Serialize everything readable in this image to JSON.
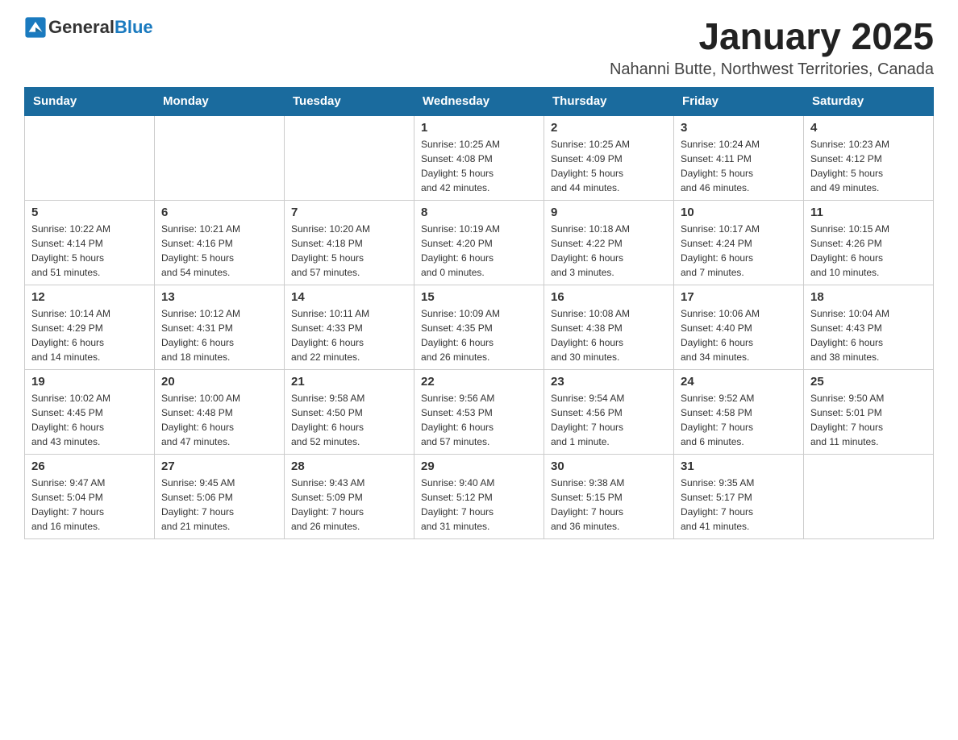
{
  "logo": {
    "general": "General",
    "blue": "Blue"
  },
  "title": "January 2025",
  "subtitle": "Nahanni Butte, Northwest Territories, Canada",
  "days_header": [
    "Sunday",
    "Monday",
    "Tuesday",
    "Wednesday",
    "Thursday",
    "Friday",
    "Saturday"
  ],
  "weeks": [
    [
      {
        "day": "",
        "info": ""
      },
      {
        "day": "",
        "info": ""
      },
      {
        "day": "",
        "info": ""
      },
      {
        "day": "1",
        "info": "Sunrise: 10:25 AM\nSunset: 4:08 PM\nDaylight: 5 hours\nand 42 minutes."
      },
      {
        "day": "2",
        "info": "Sunrise: 10:25 AM\nSunset: 4:09 PM\nDaylight: 5 hours\nand 44 minutes."
      },
      {
        "day": "3",
        "info": "Sunrise: 10:24 AM\nSunset: 4:11 PM\nDaylight: 5 hours\nand 46 minutes."
      },
      {
        "day": "4",
        "info": "Sunrise: 10:23 AM\nSunset: 4:12 PM\nDaylight: 5 hours\nand 49 minutes."
      }
    ],
    [
      {
        "day": "5",
        "info": "Sunrise: 10:22 AM\nSunset: 4:14 PM\nDaylight: 5 hours\nand 51 minutes."
      },
      {
        "day": "6",
        "info": "Sunrise: 10:21 AM\nSunset: 4:16 PM\nDaylight: 5 hours\nand 54 minutes."
      },
      {
        "day": "7",
        "info": "Sunrise: 10:20 AM\nSunset: 4:18 PM\nDaylight: 5 hours\nand 57 minutes."
      },
      {
        "day": "8",
        "info": "Sunrise: 10:19 AM\nSunset: 4:20 PM\nDaylight: 6 hours\nand 0 minutes."
      },
      {
        "day": "9",
        "info": "Sunrise: 10:18 AM\nSunset: 4:22 PM\nDaylight: 6 hours\nand 3 minutes."
      },
      {
        "day": "10",
        "info": "Sunrise: 10:17 AM\nSunset: 4:24 PM\nDaylight: 6 hours\nand 7 minutes."
      },
      {
        "day": "11",
        "info": "Sunrise: 10:15 AM\nSunset: 4:26 PM\nDaylight: 6 hours\nand 10 minutes."
      }
    ],
    [
      {
        "day": "12",
        "info": "Sunrise: 10:14 AM\nSunset: 4:29 PM\nDaylight: 6 hours\nand 14 minutes."
      },
      {
        "day": "13",
        "info": "Sunrise: 10:12 AM\nSunset: 4:31 PM\nDaylight: 6 hours\nand 18 minutes."
      },
      {
        "day": "14",
        "info": "Sunrise: 10:11 AM\nSunset: 4:33 PM\nDaylight: 6 hours\nand 22 minutes."
      },
      {
        "day": "15",
        "info": "Sunrise: 10:09 AM\nSunset: 4:35 PM\nDaylight: 6 hours\nand 26 minutes."
      },
      {
        "day": "16",
        "info": "Sunrise: 10:08 AM\nSunset: 4:38 PM\nDaylight: 6 hours\nand 30 minutes."
      },
      {
        "day": "17",
        "info": "Sunrise: 10:06 AM\nSunset: 4:40 PM\nDaylight: 6 hours\nand 34 minutes."
      },
      {
        "day": "18",
        "info": "Sunrise: 10:04 AM\nSunset: 4:43 PM\nDaylight: 6 hours\nand 38 minutes."
      }
    ],
    [
      {
        "day": "19",
        "info": "Sunrise: 10:02 AM\nSunset: 4:45 PM\nDaylight: 6 hours\nand 43 minutes."
      },
      {
        "day": "20",
        "info": "Sunrise: 10:00 AM\nSunset: 4:48 PM\nDaylight: 6 hours\nand 47 minutes."
      },
      {
        "day": "21",
        "info": "Sunrise: 9:58 AM\nSunset: 4:50 PM\nDaylight: 6 hours\nand 52 minutes."
      },
      {
        "day": "22",
        "info": "Sunrise: 9:56 AM\nSunset: 4:53 PM\nDaylight: 6 hours\nand 57 minutes."
      },
      {
        "day": "23",
        "info": "Sunrise: 9:54 AM\nSunset: 4:56 PM\nDaylight: 7 hours\nand 1 minute."
      },
      {
        "day": "24",
        "info": "Sunrise: 9:52 AM\nSunset: 4:58 PM\nDaylight: 7 hours\nand 6 minutes."
      },
      {
        "day": "25",
        "info": "Sunrise: 9:50 AM\nSunset: 5:01 PM\nDaylight: 7 hours\nand 11 minutes."
      }
    ],
    [
      {
        "day": "26",
        "info": "Sunrise: 9:47 AM\nSunset: 5:04 PM\nDaylight: 7 hours\nand 16 minutes."
      },
      {
        "day": "27",
        "info": "Sunrise: 9:45 AM\nSunset: 5:06 PM\nDaylight: 7 hours\nand 21 minutes."
      },
      {
        "day": "28",
        "info": "Sunrise: 9:43 AM\nSunset: 5:09 PM\nDaylight: 7 hours\nand 26 minutes."
      },
      {
        "day": "29",
        "info": "Sunrise: 9:40 AM\nSunset: 5:12 PM\nDaylight: 7 hours\nand 31 minutes."
      },
      {
        "day": "30",
        "info": "Sunrise: 9:38 AM\nSunset: 5:15 PM\nDaylight: 7 hours\nand 36 minutes."
      },
      {
        "day": "31",
        "info": "Sunrise: 9:35 AM\nSunset: 5:17 PM\nDaylight: 7 hours\nand 41 minutes."
      },
      {
        "day": "",
        "info": ""
      }
    ]
  ]
}
